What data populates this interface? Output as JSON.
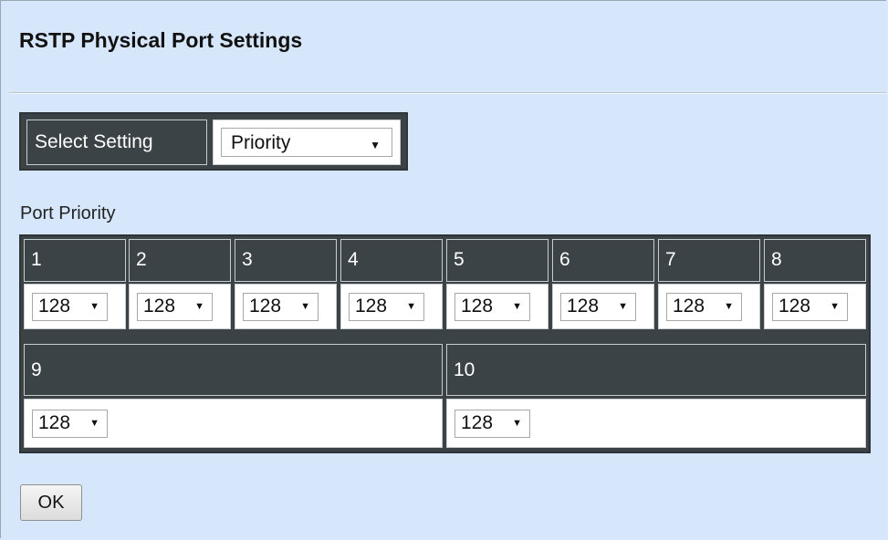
{
  "page": {
    "title": "RSTP Physical Port Settings"
  },
  "setting": {
    "label": "Select Setting",
    "value": "Priority",
    "arrow": "▼"
  },
  "section": {
    "label": "Port Priority"
  },
  "ports": [
    {
      "port": "1",
      "priority": "128"
    },
    {
      "port": "2",
      "priority": "128"
    },
    {
      "port": "3",
      "priority": "128"
    },
    {
      "port": "4",
      "priority": "128"
    },
    {
      "port": "5",
      "priority": "128"
    },
    {
      "port": "6",
      "priority": "128"
    },
    {
      "port": "7",
      "priority": "128"
    },
    {
      "port": "8",
      "priority": "128"
    },
    {
      "port": "9",
      "priority": "128"
    },
    {
      "port": "10",
      "priority": "128"
    }
  ],
  "dropdown_arrow": "▼",
  "ok_button": "OK"
}
